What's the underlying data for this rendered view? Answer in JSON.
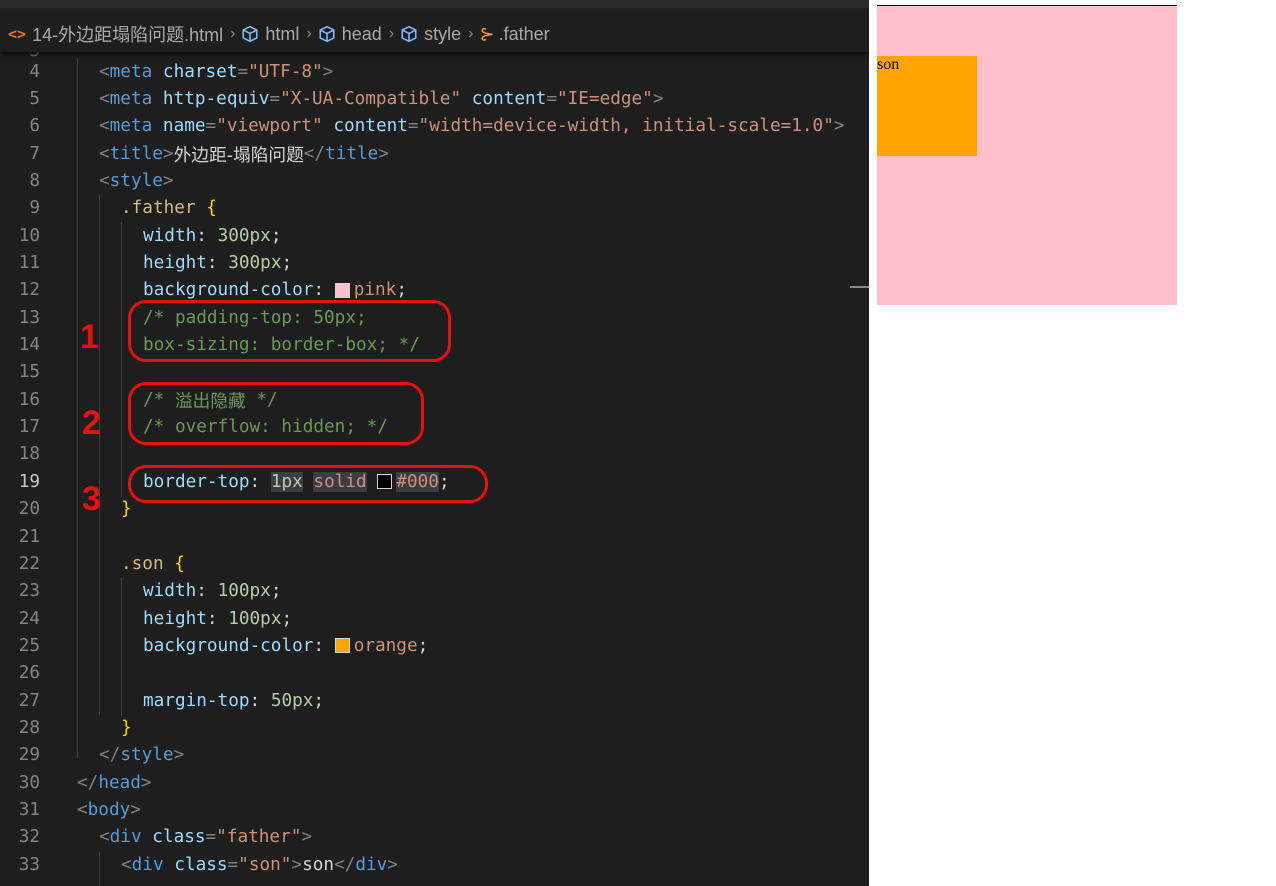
{
  "breadcrumb": {
    "file": "14-外边距塌陷问题.html",
    "items": [
      "html",
      "head",
      "style",
      ".father"
    ]
  },
  "top_partial_line": "3",
  "lines": [
    {
      "n": "4",
      "t": [
        [
          "p",
          "<"
        ],
        [
          "g",
          "meta"
        ],
        [
          "s",
          " "
        ],
        [
          "a",
          "charset"
        ],
        [
          "p",
          "="
        ],
        [
          "r",
          "\"UTF-8\""
        ],
        [
          "p",
          ">"
        ]
      ]
    },
    {
      "n": "5",
      "t": [
        [
          "p",
          "<"
        ],
        [
          "g",
          "meta"
        ],
        [
          "s",
          " "
        ],
        [
          "a",
          "http-equiv"
        ],
        [
          "p",
          "="
        ],
        [
          "r",
          "\"X-UA-Compatible\""
        ],
        [
          "s",
          " "
        ],
        [
          "a",
          "content"
        ],
        [
          "p",
          "="
        ],
        [
          "r",
          "\"IE=edge\""
        ],
        [
          "p",
          ">"
        ]
      ]
    },
    {
      "n": "6",
      "t": [
        [
          "p",
          "<"
        ],
        [
          "g",
          "meta"
        ],
        [
          "s",
          " "
        ],
        [
          "a",
          "name"
        ],
        [
          "p",
          "="
        ],
        [
          "r",
          "\"viewport\""
        ],
        [
          "s",
          " "
        ],
        [
          "a",
          "content"
        ],
        [
          "p",
          "="
        ],
        [
          "r",
          "\"width=device-width, initial-scale=1.0\""
        ],
        [
          "p",
          ">"
        ]
      ]
    },
    {
      "n": "7",
      "t": [
        [
          "p",
          "<"
        ],
        [
          "g",
          "title"
        ],
        [
          "p",
          ">"
        ],
        [
          "cjk",
          "外边距-塌陷问题"
        ],
        [
          "p",
          "</"
        ],
        [
          "g",
          "title"
        ],
        [
          "p",
          ">"
        ]
      ]
    },
    {
      "n": "8",
      "t": [
        [
          "p",
          "<"
        ],
        [
          "g",
          "style"
        ],
        [
          "p",
          ">"
        ]
      ]
    },
    {
      "n": "9",
      "t": [
        [
          "sel",
          ".father"
        ],
        [
          "s",
          " "
        ],
        [
          "b",
          "{"
        ]
      ]
    },
    {
      "n": "10",
      "t": [
        [
          "pr",
          "width"
        ],
        [
          "s",
          ": "
        ],
        [
          "nu",
          "300px"
        ],
        [
          "s",
          ";"
        ]
      ]
    },
    {
      "n": "11",
      "t": [
        [
          "pr",
          "height"
        ],
        [
          "s",
          ": "
        ],
        [
          "nu",
          "300px"
        ],
        [
          "s",
          ";"
        ]
      ]
    },
    {
      "n": "12",
      "t": [
        [
          "pr",
          "background-color"
        ],
        [
          "s",
          ": "
        ],
        [
          "sw",
          "#ffc0cb"
        ],
        [
          "v",
          "pink"
        ],
        [
          "s",
          ";"
        ]
      ]
    },
    {
      "n": "13",
      "t": [
        [
          "c",
          "/* padding-top: 50px;"
        ]
      ]
    },
    {
      "n": "14",
      "t": [
        [
          "c",
          "box-sizing: border-box; */"
        ]
      ]
    },
    {
      "n": "15",
      "t": []
    },
    {
      "n": "16",
      "t": [
        [
          "c",
          "/* "
        ],
        [
          "ccjk",
          "溢出隐藏"
        ],
        [
          "c",
          " */"
        ]
      ]
    },
    {
      "n": "17",
      "t": [
        [
          "c",
          "/* overflow: hidden; */"
        ]
      ]
    },
    {
      "n": "18",
      "t": []
    },
    {
      "n": "19",
      "t": [
        [
          "pr",
          "border-top"
        ],
        [
          "s",
          ": "
        ],
        [
          "nuh",
          "1px"
        ],
        [
          "s",
          " "
        ],
        [
          "vh",
          "solid"
        ],
        [
          "s",
          " "
        ],
        [
          "sw",
          "#000000"
        ],
        [
          "vh",
          "#000"
        ],
        [
          "s",
          ";"
        ]
      ]
    },
    {
      "n": "20",
      "t": [
        [
          "b",
          "}"
        ]
      ]
    },
    {
      "n": "21",
      "t": []
    },
    {
      "n": "22",
      "t": [
        [
          "sel",
          ".son"
        ],
        [
          "s",
          " "
        ],
        [
          "b",
          "{"
        ]
      ]
    },
    {
      "n": "23",
      "t": [
        [
          "pr",
          "width"
        ],
        [
          "s",
          ": "
        ],
        [
          "nu",
          "100px"
        ],
        [
          "s",
          ";"
        ]
      ]
    },
    {
      "n": "24",
      "t": [
        [
          "pr",
          "height"
        ],
        [
          "s",
          ": "
        ],
        [
          "nu",
          "100px"
        ],
        [
          "s",
          ";"
        ]
      ]
    },
    {
      "n": "25",
      "t": [
        [
          "pr",
          "background-color"
        ],
        [
          "s",
          ": "
        ],
        [
          "sw",
          "#ffa500"
        ],
        [
          "v",
          "orange"
        ],
        [
          "s",
          ";"
        ]
      ]
    },
    {
      "n": "26",
      "t": []
    },
    {
      "n": "27",
      "t": [
        [
          "pr",
          "margin-top"
        ],
        [
          "s",
          ": "
        ],
        [
          "nu",
          "50px"
        ],
        [
          "s",
          ";"
        ]
      ]
    },
    {
      "n": "28",
      "t": [
        [
          "b",
          "}"
        ]
      ]
    },
    {
      "n": "29",
      "t": [
        [
          "p",
          "</"
        ],
        [
          "g",
          "style"
        ],
        [
          "p",
          ">"
        ]
      ]
    },
    {
      "n": "30",
      "t": [
        [
          "p",
          "</"
        ],
        [
          "g",
          "head"
        ],
        [
          "p",
          ">"
        ]
      ]
    },
    {
      "n": "31",
      "t": [
        [
          "p",
          "<"
        ],
        [
          "g",
          "body"
        ],
        [
          "p",
          ">"
        ]
      ]
    },
    {
      "n": "32",
      "t": [
        [
          "p",
          "<"
        ],
        [
          "g",
          "div"
        ],
        [
          "s",
          " "
        ],
        [
          "a",
          "class"
        ],
        [
          "p",
          "="
        ],
        [
          "r",
          "\"father\""
        ],
        [
          "p",
          ">"
        ]
      ]
    },
    {
      "n": "33",
      "t": [
        [
          "p",
          "<"
        ],
        [
          "g",
          "div"
        ],
        [
          "s",
          " "
        ],
        [
          "a",
          "class"
        ],
        [
          "p",
          "="
        ],
        [
          "r",
          "\"son\""
        ],
        [
          "p",
          ">"
        ],
        [
          "s",
          "son"
        ],
        [
          "p",
          "</"
        ],
        [
          "g",
          "div"
        ],
        [
          "p",
          ">"
        ]
      ]
    }
  ],
  "annotations": [
    "1",
    "2",
    "3"
  ],
  "preview": {
    "son_text": "son"
  },
  "colors": {
    "editor_bg": "#1e1e1e",
    "annotation": "#e81010",
    "father_bg": "#ffc0cb",
    "son_bg": "#ffa500"
  }
}
